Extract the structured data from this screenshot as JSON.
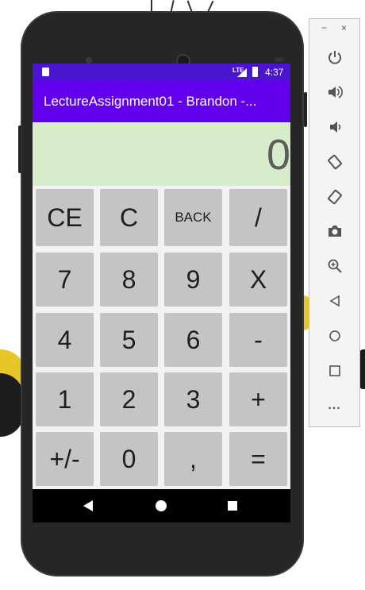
{
  "status_bar": {
    "network": "LTE",
    "time": "4:37"
  },
  "app_bar": {
    "title": "LectureAssignment01 - Brandon -..."
  },
  "display": {
    "value": "0"
  },
  "keys": [
    [
      "CE",
      "C",
      "BACK",
      "/"
    ],
    [
      "7",
      "8",
      "9",
      "X"
    ],
    [
      "4",
      "5",
      "6",
      "-"
    ],
    [
      "1",
      "2",
      "3",
      "+"
    ],
    [
      "+/-",
      "0",
      ",",
      "="
    ]
  ],
  "emulator_panel": {
    "window_controls": [
      "−",
      "×"
    ],
    "buttons": [
      "power-icon",
      "volume-up-icon",
      "volume-down-icon",
      "rotate-left-icon",
      "rotate-right-icon",
      "camera-icon",
      "zoom-icon",
      "back-icon",
      "home-icon",
      "overview-icon",
      "more-icon"
    ],
    "more_label": "..."
  },
  "colors": {
    "status_bar": "#4b14d1",
    "app_bar": "#6200ee",
    "display_bg": "#d6eccb",
    "key_bg": "#c4c4c4"
  }
}
